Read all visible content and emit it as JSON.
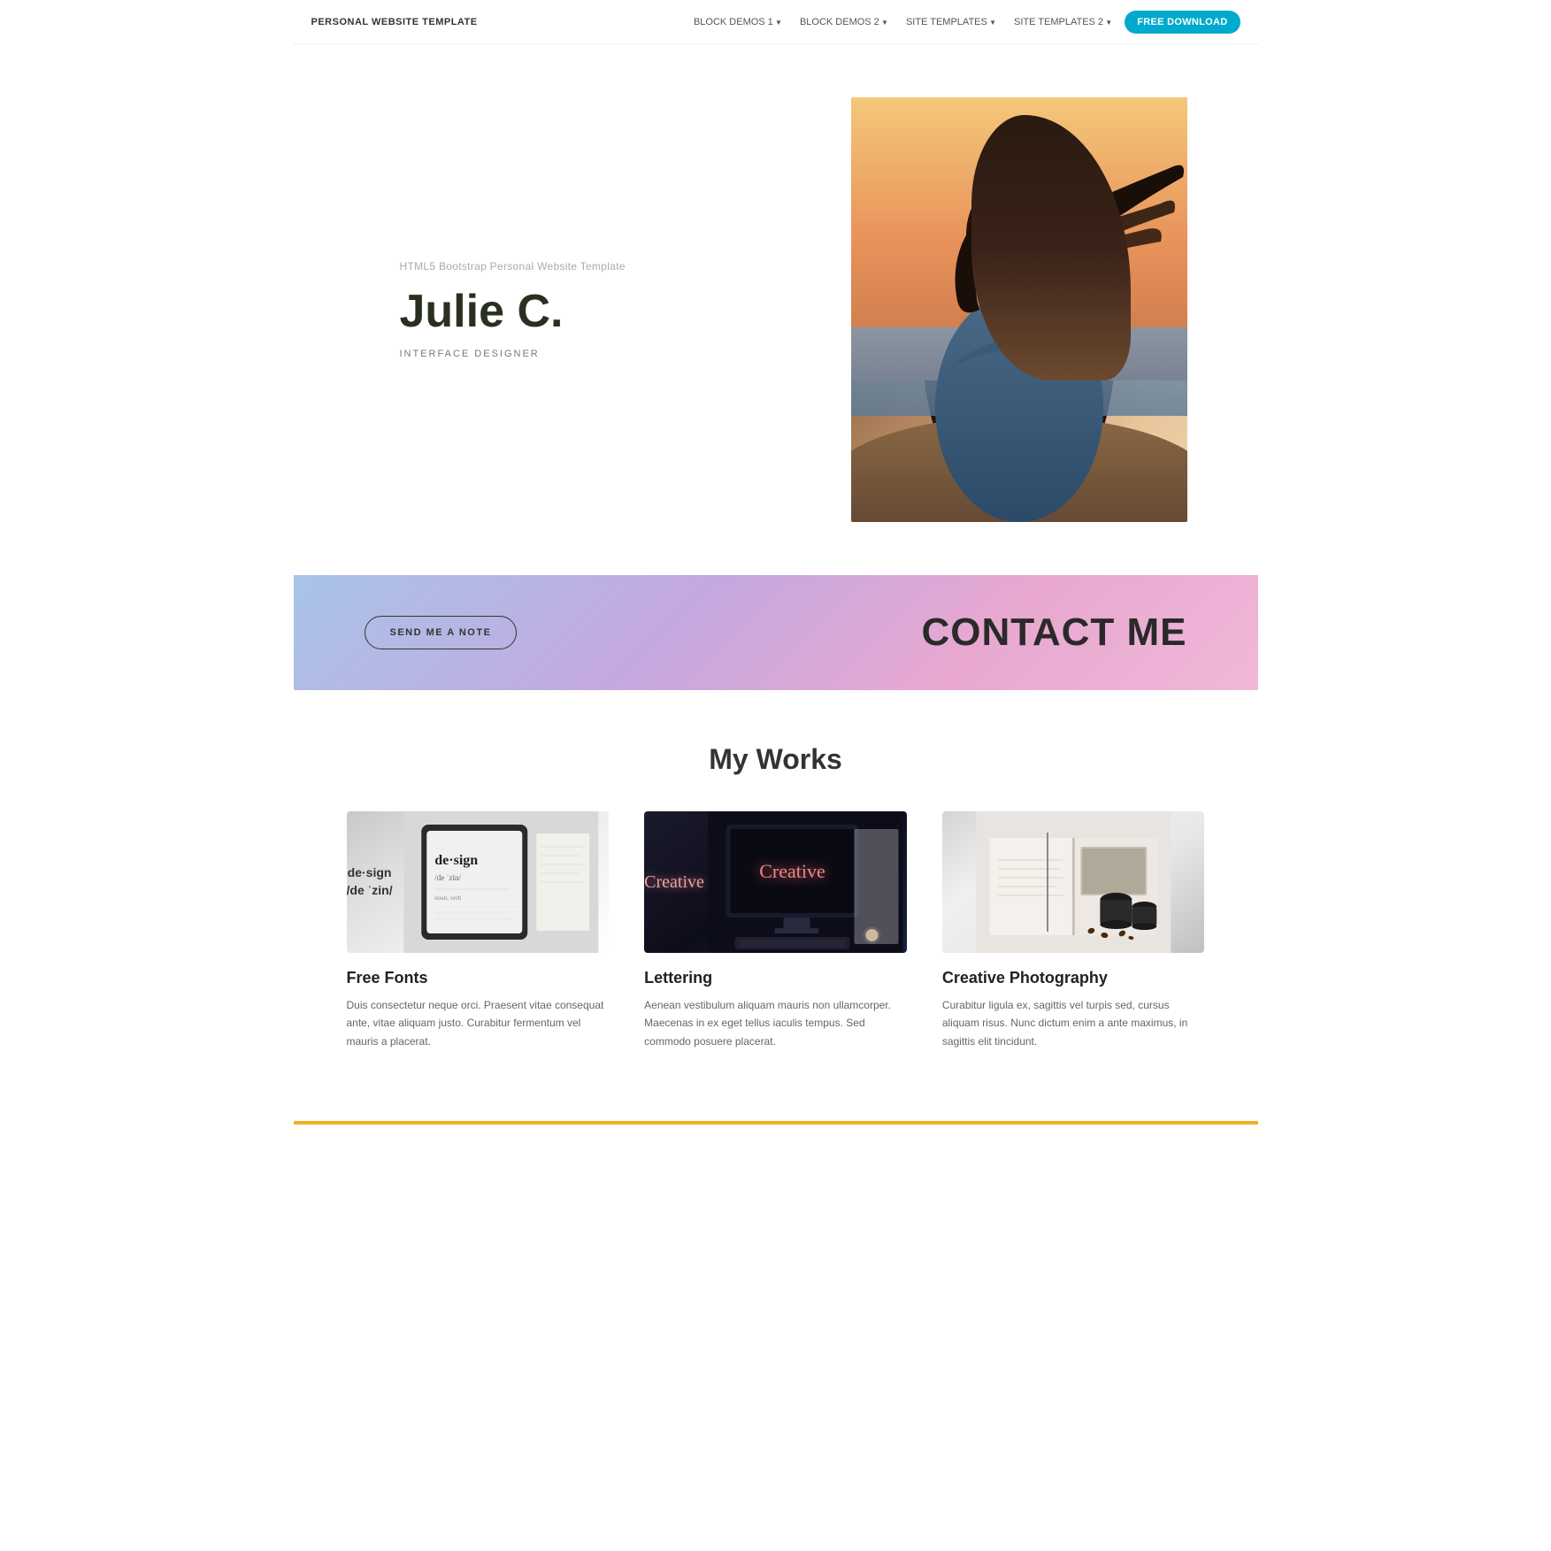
{
  "nav": {
    "brand": "PERSONAL WEBSITE TEMPLATE",
    "links": [
      {
        "label": "BLOCK DEMOS 1",
        "id": "block-demos-1"
      },
      {
        "label": "BLOCK DEMOS 2",
        "id": "block-demos-2"
      },
      {
        "label": "SITE TEMPLATES",
        "id": "site-templates"
      },
      {
        "label": "SITE TEMPLATES 2",
        "id": "site-templates-2"
      }
    ],
    "cta": "FREE DOWNLOAD"
  },
  "hero": {
    "subtitle": "HTML5 Bootstrap Personal Website Template",
    "name": "Julie C.",
    "role": "INTERFACE DESIGNER"
  },
  "contact": {
    "button": "SEND ME A NOTE",
    "title": "CONTACT ME"
  },
  "works": {
    "section_title": "My Works",
    "items": [
      {
        "id": "free-fonts",
        "title": "Free Fonts",
        "description": "Duis consectetur neque orci. Praesent vitae consequat ante, vitae aliquam justo. Curabitur fermentum vel mauris a placerat."
      },
      {
        "id": "lettering",
        "title": "Lettering",
        "description": "Aenean vestibulum aliquam mauris non ullamcorper. Maecenas in ex eget tellus iaculis tempus. Sed commodo posuere placerat."
      },
      {
        "id": "creative-photography",
        "title": "Creative Photography",
        "description": "Curabitur ligula ex, sagittis vel turpis sed, cursus aliquam risus. Nunc dictum enim a ante maximus, in sagittis elit tincidunt."
      }
    ]
  }
}
